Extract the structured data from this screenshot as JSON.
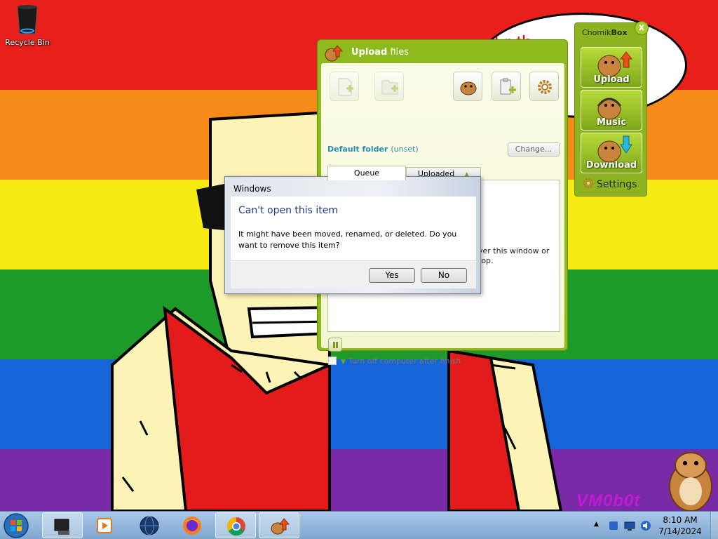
{
  "desktop": {
    "recycle_bin_label": "Recycle Bin",
    "bubble_text": "l r th",
    "watermark": "VM0b0t"
  },
  "upload_window": {
    "title_bold": "Upload",
    "title_rest": "files",
    "default_folder_label": "Default folder",
    "default_folder_value": "(unset)",
    "change_button": "Change...",
    "tabs": [
      {
        "label": "Queue"
      },
      {
        "label": "Uploaded"
      }
    ],
    "queue_hint_line1": "ver this window or",
    "queue_hint_line2": "top.",
    "shutdown_label": "Turn off computer after finish"
  },
  "chomikbox": {
    "title_regular": "Chomik",
    "title_bold": "Box",
    "close_label": "x",
    "buttons": [
      {
        "label": "Upload"
      },
      {
        "label": "Music"
      },
      {
        "label": "Download"
      }
    ],
    "settings_label": "Settings"
  },
  "dialog": {
    "title": "Windows",
    "heading": "Can't open this item",
    "message": "It might have been moved, renamed, or deleted. Do you want to remove this item?",
    "yes_button": "Yes",
    "no_button": "No"
  },
  "taskbar": {
    "clock_time": "8:10 AM",
    "clock_date": "7/14/2024"
  },
  "colors": {
    "accent_green": "#8fba1e",
    "dialog_heading": "#1e3c8c",
    "folder_link": "#2b8cb0"
  }
}
